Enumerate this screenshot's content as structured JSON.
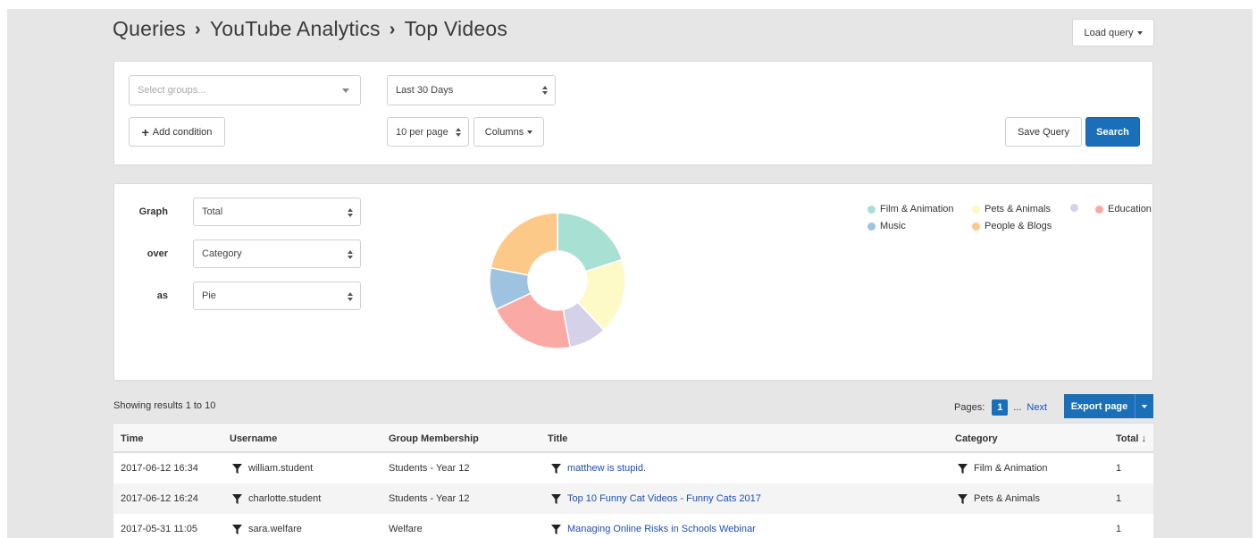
{
  "breadcrumb": [
    "Queries",
    "YouTube Analytics",
    "Top Videos"
  ],
  "load_query": "Load query",
  "query": {
    "groups_placeholder": "Select groups...",
    "date_range": "Last 30 Days",
    "add_condition": "Add condition",
    "per_page": "10 per page",
    "columns": "Columns",
    "save_query": "Save Query",
    "search": "Search"
  },
  "graph": {
    "graph_label": "Graph",
    "graph_value": "Total",
    "over_label": "over",
    "over_value": "Category",
    "as_label": "as",
    "as_value": "Pie"
  },
  "chart_data": {
    "type": "pie",
    "categories": [
      "Film & Animation",
      "Pets & Animals",
      "",
      "Education",
      "Music",
      "People & Blogs"
    ],
    "values": [
      20,
      18,
      9,
      21,
      10,
      22
    ],
    "colors": [
      "#a8e0d3",
      "#fdfac8",
      "#d4d1e9",
      "#fba9a5",
      "#9ec3e0",
      "#fcc989"
    ],
    "donut": true
  },
  "results": {
    "showing": "Showing results 1 to 10",
    "pages_label": "Pages:",
    "current_page": "1",
    "ellipsis": "...",
    "next": "Next",
    "export": "Export page"
  },
  "table": {
    "headers": [
      "Time",
      "Username",
      "Group Membership",
      "Title",
      "Category",
      "Total ↓"
    ],
    "rows": [
      [
        "2017-06-12 16:34",
        "william.student",
        "Students - Year 12",
        "matthew is stupid.",
        "Film & Animation",
        "1"
      ],
      [
        "2017-06-12 16:24",
        "charlotte.student",
        "Students - Year 12",
        "Top 10 Funny Cat Videos - Funny Cats 2017",
        "Pets & Animals",
        "1"
      ],
      [
        "2017-05-31 11:05",
        "sara.welfare",
        "Welfare",
        "Managing Online Risks in Schools Webinar",
        "",
        "1"
      ]
    ]
  }
}
